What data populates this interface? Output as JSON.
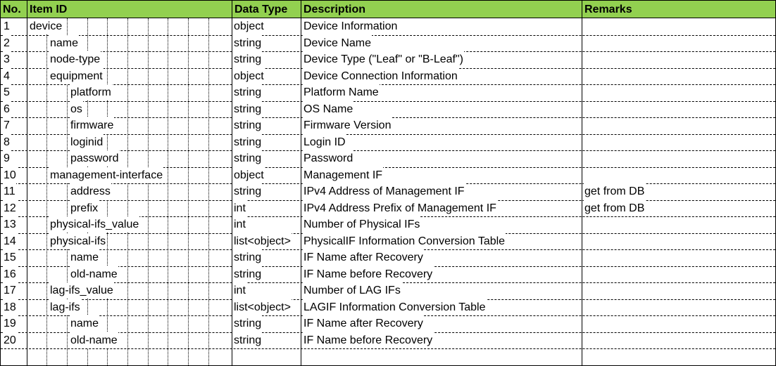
{
  "headers": {
    "no": "No.",
    "item_id": "Item ID",
    "data_type": "Data Type",
    "description": "Description",
    "remarks": "Remarks"
  },
  "colors": {
    "header_bg": "#92d050",
    "grid": "#000000"
  },
  "rows": [
    {
      "no": "1",
      "item": "device",
      "level": 0,
      "type": "object",
      "desc": "Device Information",
      "remarks": ""
    },
    {
      "no": "2",
      "item": "name",
      "level": 1,
      "type": "string",
      "desc": "Device Name",
      "remarks": ""
    },
    {
      "no": "3",
      "item": "node-type",
      "level": 1,
      "type": "string",
      "desc": "Device Type (\"Leaf\" or \"B-Leaf\")",
      "remarks": ""
    },
    {
      "no": "4",
      "item": "equipment",
      "level": 1,
      "type": "object",
      "desc": "Device Connection Information",
      "remarks": ""
    },
    {
      "no": "5",
      "item": "platform",
      "level": 2,
      "type": "string",
      "desc": "Platform Name",
      "remarks": ""
    },
    {
      "no": "6",
      "item": "os",
      "level": 2,
      "type": "string",
      "desc": "OS Name",
      "remarks": ""
    },
    {
      "no": "7",
      "item": "firmware",
      "level": 2,
      "type": "string",
      "desc": "Firmware Version",
      "remarks": ""
    },
    {
      "no": "8",
      "item": "loginid",
      "level": 2,
      "type": "string",
      "desc": "Login ID",
      "remarks": ""
    },
    {
      "no": "9",
      "item": "password",
      "level": 2,
      "type": "string",
      "desc": "Password",
      "remarks": ""
    },
    {
      "no": "10",
      "item": "management-interface",
      "level": 1,
      "type": "object",
      "desc": "Management IF",
      "remarks": ""
    },
    {
      "no": "11",
      "item": "address",
      "level": 2,
      "type": "string",
      "desc": "IPv4 Address of Management IF",
      "remarks": "get from DB"
    },
    {
      "no": "12",
      "item": "prefix",
      "level": 2,
      "type": "int",
      "desc": "IPv4 Address Prefix of Management IF",
      "remarks": "get from DB"
    },
    {
      "no": "13",
      "item": "physical-ifs_value",
      "level": 1,
      "type": "int",
      "desc": "Number of Physical IFs",
      "remarks": ""
    },
    {
      "no": "14",
      "item": "physical-ifs",
      "level": 1,
      "type": "list<object>",
      "desc": "PhysicalIF Information Conversion Table",
      "remarks": ""
    },
    {
      "no": "15",
      "item": "name",
      "level": 2,
      "type": "string",
      "desc": "IF Name after Recovery",
      "remarks": ""
    },
    {
      "no": "16",
      "item": "old-name",
      "level": 2,
      "type": "string",
      "desc": "IF Name before Recovery",
      "remarks": ""
    },
    {
      "no": "17",
      "item": "lag-ifs_value",
      "level": 1,
      "type": "int",
      "desc": "Number of LAG IFs",
      "remarks": ""
    },
    {
      "no": "18",
      "item": "lag-ifs",
      "level": 1,
      "type": "list<object>",
      "desc": "LAGIF Information Conversion Table",
      "remarks": ""
    },
    {
      "no": "19",
      "item": "name",
      "level": 2,
      "type": "string",
      "desc": "IF Name after Recovery",
      "remarks": ""
    },
    {
      "no": "20",
      "item": "old-name",
      "level": 2,
      "type": "string",
      "desc": "IF Name before Recovery",
      "remarks": ""
    },
    {
      "no": "",
      "item": "",
      "level": 0,
      "type": "",
      "desc": "",
      "remarks": ""
    }
  ]
}
